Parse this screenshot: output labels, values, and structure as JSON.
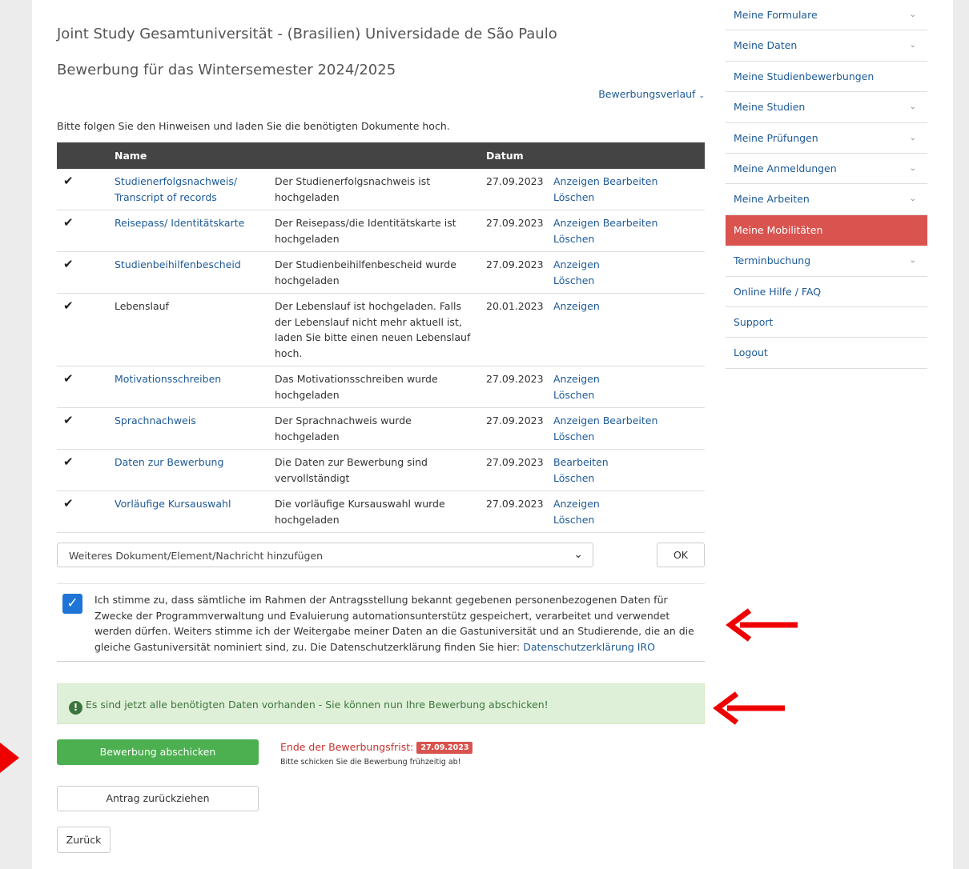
{
  "page": {
    "title": "Joint Study Gesamtuniversität - (Brasilien) Universidade de São Paulo",
    "subtitle": "Bewerbung für das Wintersemester 2024/2025",
    "history_link": "Bewerbungsverlauf",
    "instruction": "Bitte folgen Sie den Hinweisen und laden Sie die benötigten Dokumente hoch."
  },
  "table": {
    "headers": {
      "name": "Name",
      "date": "Datum"
    },
    "rows": [
      {
        "name": "Studienerfolgsnachweis/ Transcript of records",
        "desc": "Der Studienerfolgsnachweis ist hochgeladen",
        "date": "27.09.2023",
        "actions": [
          "Anzeigen",
          "Bearbeiten",
          "Löschen"
        ]
      },
      {
        "name": "Reisepass/ Identitätskarte",
        "desc": "Der Reisepass/die Identitätskarte ist hochgeladen",
        "date": "27.09.2023",
        "actions": [
          "Anzeigen",
          "Bearbeiten",
          "Löschen"
        ]
      },
      {
        "name": "Studienbeihilfenbescheid",
        "desc": "Der Studienbeihilfenbescheid wurde hochgeladen",
        "date": "27.09.2023",
        "actions": [
          "Anzeigen",
          "Löschen"
        ]
      },
      {
        "name": "Lebenslauf",
        "desc": "Der Lebenslauf ist hochgeladen. Falls der Lebenslauf nicht mehr aktuell ist, laden Sie bitte einen neuen Lebenslauf hoch.",
        "date": "20.01.2023",
        "actions": [
          "Anzeigen"
        ]
      },
      {
        "name": "Motivationsschreiben",
        "desc": "Das Motivationsschreiben wurde hochgeladen",
        "date": "27.09.2023",
        "actions": [
          "Anzeigen",
          "Löschen"
        ]
      },
      {
        "name": "Sprachnachweis",
        "desc": "Der Sprachnachweis wurde hochgeladen",
        "date": "27.09.2023",
        "actions": [
          "Anzeigen",
          "Bearbeiten",
          "Löschen"
        ]
      },
      {
        "name": "Daten zur Bewerbung",
        "desc": "Die Daten zur Bewerbung sind vervollständigt",
        "date": "27.09.2023",
        "actions": [
          "Bearbeiten",
          "Löschen"
        ]
      },
      {
        "name": "Vorläufige Kursauswahl",
        "desc": "Die vorläufige Kursauswahl wurde hochgeladen",
        "date": "27.09.2023",
        "actions": [
          "Anzeigen",
          "Löschen"
        ]
      }
    ]
  },
  "add_document": {
    "selected": "Weiteres Dokument/Element/Nachricht hinzufügen",
    "ok_label": "OK"
  },
  "consent": {
    "text": "Ich stimme zu, dass sämtliche im Rahmen der Antragsstellung bekannt gegebenen personenbezogenen Daten für Zwecke der Programmverwaltung und Evaluierung automationsunterstütz gespeichert, verarbeitet und verwendet werden dürfen. Weiters stimme ich der Weitergabe meiner Daten an die Gastuniversität und an Studierende, die an die gleiche Gastuniversität nominiert sind, zu. Die Datenschutzerklärung finden Sie hier: ",
    "link": "Datenschutzerklärung IRO",
    "checked": true
  },
  "alert": {
    "text": "Es sind jetzt alle benötigten Daten vorhanden - Sie können nun Ihre Bewerbung abschicken!"
  },
  "actions": {
    "submit": "Bewerbung abschicken",
    "deadline_label": "Ende der Bewerbungsfrist:",
    "deadline_date": "27.09.2023",
    "deadline_note": "Bitte schicken Sie die Bewerbung frühzeitig ab!",
    "withdraw": "Antrag zurückziehen",
    "back": "Zurück"
  },
  "sidebar": {
    "items": [
      {
        "label": "Meine Formulare",
        "has_chevron": true,
        "active": false
      },
      {
        "label": "Meine Daten",
        "has_chevron": true,
        "active": false
      },
      {
        "label": "Meine Studienbewerbungen",
        "has_chevron": false,
        "active": false
      },
      {
        "label": "Meine Studien",
        "has_chevron": true,
        "active": false
      },
      {
        "label": "Meine Prüfungen",
        "has_chevron": true,
        "active": false
      },
      {
        "label": "Meine Anmeldungen",
        "has_chevron": true,
        "active": false
      },
      {
        "label": "Meine Arbeiten",
        "has_chevron": true,
        "active": false
      },
      {
        "label": "Meine Mobilitäten",
        "has_chevron": false,
        "active": true
      },
      {
        "label": "Terminbuchung",
        "has_chevron": true,
        "active": false
      },
      {
        "label": "Online Hilfe / FAQ",
        "has_chevron": false,
        "active": false
      },
      {
        "label": "Support",
        "has_chevron": false,
        "active": false
      },
      {
        "label": "Logout",
        "has_chevron": false,
        "active": false
      }
    ]
  },
  "colors": {
    "accent_red": "#d9534f",
    "link_blue": "#1d5a96",
    "success_green": "#4caf50",
    "annotation_arrow": "#ee0000"
  }
}
